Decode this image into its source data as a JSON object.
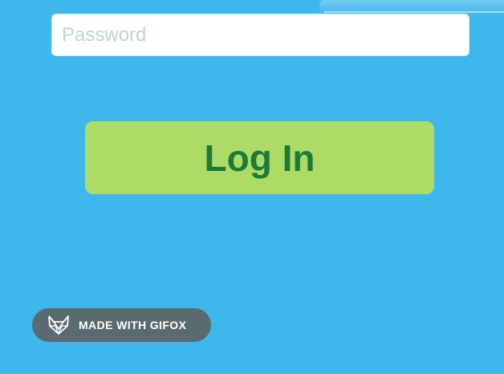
{
  "login_form": {
    "password_placeholder": "Password",
    "password_value": "",
    "login_label": "Log In"
  },
  "watermark": {
    "label": "MADE WITH GIFOX",
    "icon": "fox-head-icon"
  },
  "colors": {
    "background": "#3eb8ec",
    "button_background": "#addc66",
    "button_text": "#1e7a3a",
    "placeholder_text": "#b7dcc0",
    "badge_background": "#5a6b70"
  }
}
